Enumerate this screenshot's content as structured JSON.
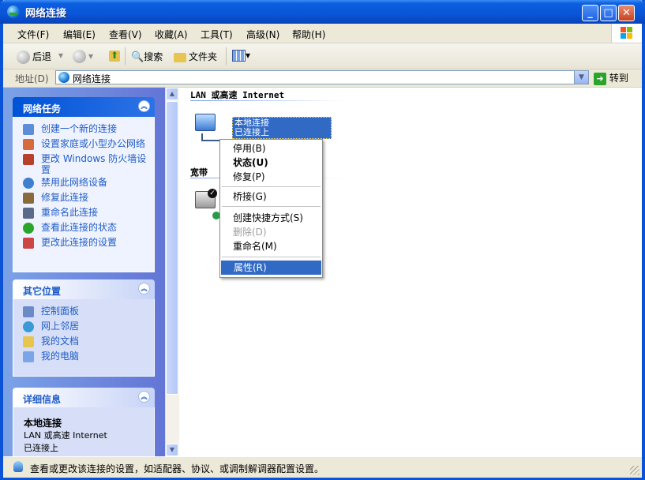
{
  "window": {
    "title": "网络连接",
    "buttons": {
      "minimize": "_",
      "maximize": "□",
      "close": "✕"
    }
  },
  "menubar": {
    "items": [
      "文件(F)",
      "编辑(E)",
      "查看(V)",
      "收藏(A)",
      "工具(T)",
      "高级(N)",
      "帮助(H)"
    ]
  },
  "toolbar": {
    "back": "后退",
    "forward_arrow": "▾",
    "search": "搜索",
    "folders": "文件夹",
    "views_arrow": "▾"
  },
  "address": {
    "label": "地址(D)",
    "value": "网络连接",
    "go": "转到"
  },
  "left": {
    "network_tasks": {
      "title": "网络任务",
      "items": [
        "创建一个新的连接",
        "设置家庭或小型办公网络",
        "更改 Windows 防火墙设置",
        "禁用此网络设备",
        "修复此连接",
        "重命名此连接",
        "查看此连接的状态",
        "更改此连接的设置"
      ]
    },
    "other_places": {
      "title": "其它位置",
      "items": [
        "控制面板",
        "网上邻居",
        "我的文档",
        "我的电脑"
      ]
    },
    "details": {
      "title": "详细信息",
      "name": "本地连接",
      "type": "LAN 或高速 Internet",
      "status": "已连接上"
    }
  },
  "content": {
    "group_lan": "LAN 或高速 Internet",
    "group_broadband": "宽带",
    "lan_item": {
      "name": "本地连接",
      "status": "已连接上"
    }
  },
  "context_menu": {
    "items": [
      {
        "label": "停用(B)"
      },
      {
        "label": "状态(U)"
      },
      {
        "label": "修复(P)"
      },
      {
        "label": "桥接(G)"
      },
      {
        "label": "创建快捷方式(S)"
      },
      {
        "label": "删除(D)"
      },
      {
        "label": "重命名(M)"
      },
      {
        "label": "属性(R)"
      }
    ]
  },
  "status_bar": {
    "text": "查看或更改该连接的设置，如适配器、协议、或调制解调器配置设置。"
  },
  "colors": {
    "titlebar": "#0a55d8",
    "task_link": "#215dc6",
    "selection": "#316ac5"
  }
}
